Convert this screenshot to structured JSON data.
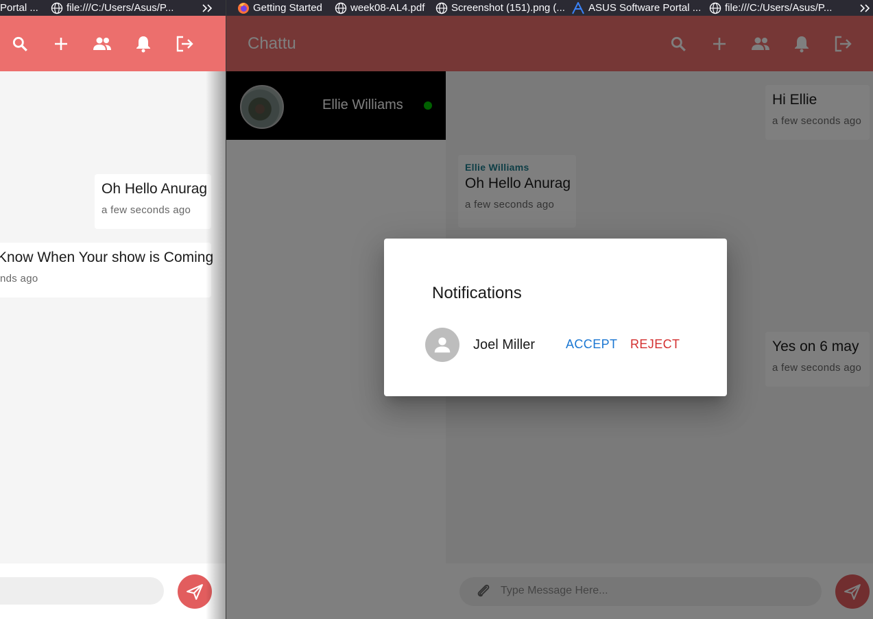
{
  "left_window": {
    "bookmarks": [
      {
        "label": "Portal ...",
        "icon": "none"
      },
      {
        "label": "file:///C:/Users/Asus/P...",
        "icon": "globe-icon"
      }
    ],
    "messages": [
      {
        "text": "Oh Hello Anurag",
        "time": "a few seconds ago"
      },
      {
        "text": "Know When Your show is Coming",
        "time": "nds ago"
      }
    ]
  },
  "right_window": {
    "bookmarks": [
      {
        "label": "Getting Started",
        "icon": "firefox-icon"
      },
      {
        "label": "week08-AL4.pdf",
        "icon": "globe-icon"
      },
      {
        "label": "Screenshot (151).png (...",
        "icon": "globe-icon"
      },
      {
        "label": "ASUS Software Portal ...",
        "icon": "asus-icon"
      },
      {
        "label": "file:///C:/Users/Asus/P...",
        "icon": "globe-icon"
      }
    ],
    "app_title": "Chattu",
    "contact": {
      "name": "Ellie Williams",
      "status": "online"
    },
    "messages": [
      {
        "sender": "",
        "text": "Hi Ellie",
        "time": "a few seconds ago",
        "side": "right"
      },
      {
        "sender": "Ellie Williams",
        "text": "Oh Hello Anurag",
        "time": "a few seconds ago",
        "side": "left"
      },
      {
        "sender": "",
        "text": "Yes on 6 may",
        "time": "a few seconds ago",
        "side": "right"
      }
    ],
    "input": {
      "placeholder": "Type Message Here..."
    },
    "dialog": {
      "title": "Notifications",
      "request": {
        "name": "Joel Miller",
        "accept_label": "ACCEPT",
        "reject_label": "REJECT"
      }
    }
  },
  "toolbar_icons": [
    "search-icon",
    "add-icon",
    "people-icon",
    "bell-icon",
    "logout-icon"
  ],
  "colors": {
    "appbar": "#ec6f6d",
    "send_button": "#e25d5e",
    "accept": "#1976d2",
    "reject": "#d32f2f",
    "sender_name": "#1c7c8c",
    "online": "#00c000"
  }
}
